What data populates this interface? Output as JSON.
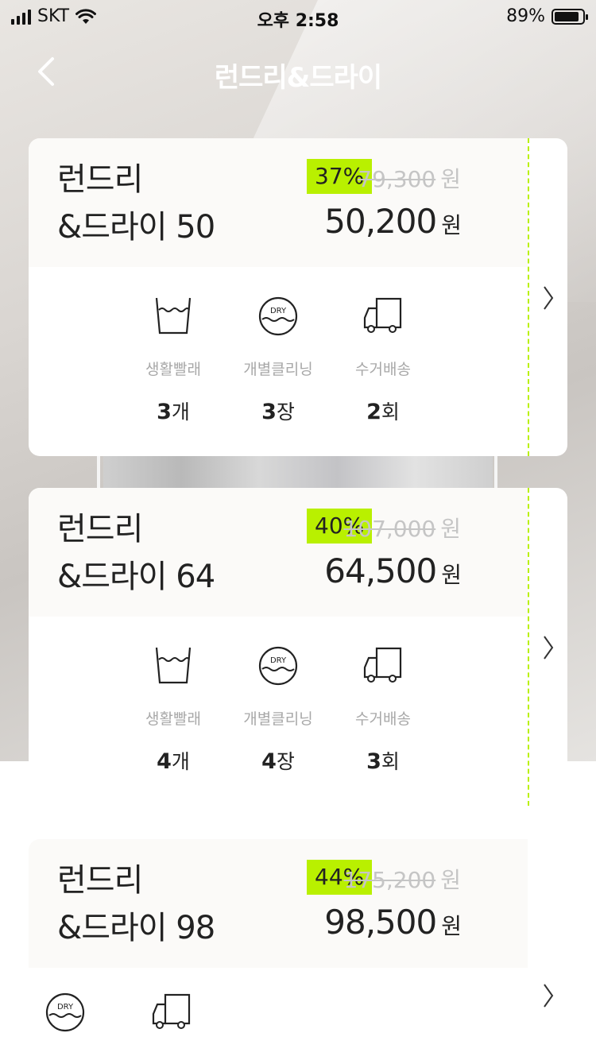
{
  "status_bar": {
    "carrier": "SKT",
    "time": "오후 2:58",
    "battery": "89%"
  },
  "nav": {
    "title": "런드리&드라이"
  },
  "products": [
    {
      "name_line1": "런드리",
      "name_line2": "&드라이 50",
      "discount": "37%",
      "original_price": "79,300",
      "price": "50,200",
      "currency": "원",
      "features": [
        {
          "icon": "laundry-basket-icon",
          "label": "생활빨래",
          "count": "3",
          "unit": "개"
        },
        {
          "icon": "dry-clean-icon",
          "label": "개별클리닝",
          "count": "3",
          "unit": "장"
        },
        {
          "icon": "delivery-truck-icon",
          "label": "수거배송",
          "count": "2",
          "unit": "회"
        }
      ]
    },
    {
      "name_line1": "런드리",
      "name_line2": "&드라이 64",
      "discount": "40%",
      "original_price": "107,000",
      "price": "64,500",
      "currency": "원",
      "features": [
        {
          "icon": "laundry-basket-icon",
          "label": "생활빨래",
          "count": "4",
          "unit": "개"
        },
        {
          "icon": "dry-clean-icon",
          "label": "개별클리닝",
          "count": "4",
          "unit": "장"
        },
        {
          "icon": "delivery-truck-icon",
          "label": "수거배송",
          "count": "3",
          "unit": "회"
        }
      ]
    },
    {
      "name_line1": "런드리",
      "name_line2": "&드라이 98",
      "discount": "44%",
      "original_price": "175,200",
      "price": "98,500",
      "currency": "원",
      "features": [
        {
          "icon": "dry-clean-icon"
        },
        {
          "icon": "delivery-truck-icon"
        }
      ]
    }
  ],
  "icons": {
    "dry_text": "DRY"
  },
  "colors": {
    "accent": "#b9f000",
    "card_head_bg": "#fbfaf8",
    "muted_text": "#a8a8a8"
  }
}
